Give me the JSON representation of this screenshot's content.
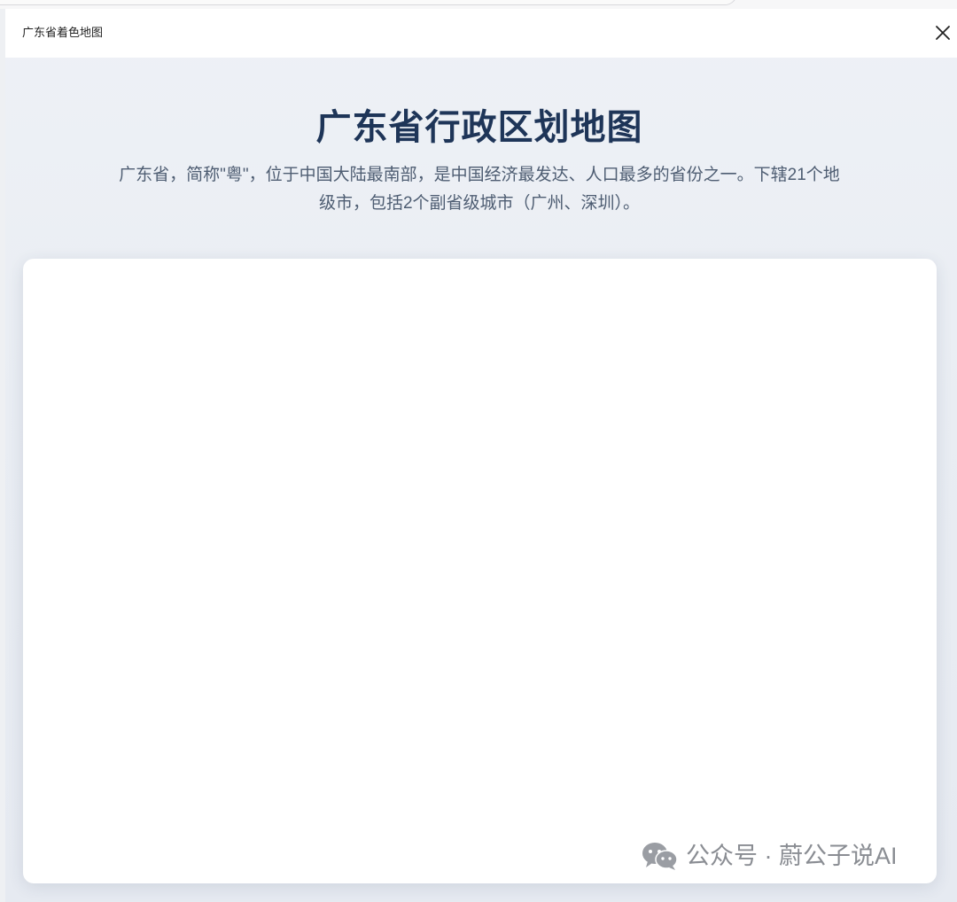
{
  "window": {
    "title": "广东省着色地图"
  },
  "page": {
    "heading": "广东省行政区划地图",
    "description": "广东省，简称\"粤\"，位于中国大陆最南部，是中国经济最发达、人口最多的省份之一。下辖21个地级市，包括2个副省级城市（广州、深圳）。"
  },
  "icons": {
    "close": "close-icon",
    "wechat": "wechat-icon"
  },
  "watermark": {
    "text": "公众号 · 蔚公子说AI"
  },
  "colors": {
    "heading": "#1e3558",
    "description": "#4e5d72",
    "background": "#e9edf3",
    "card": "#ffffff"
  }
}
